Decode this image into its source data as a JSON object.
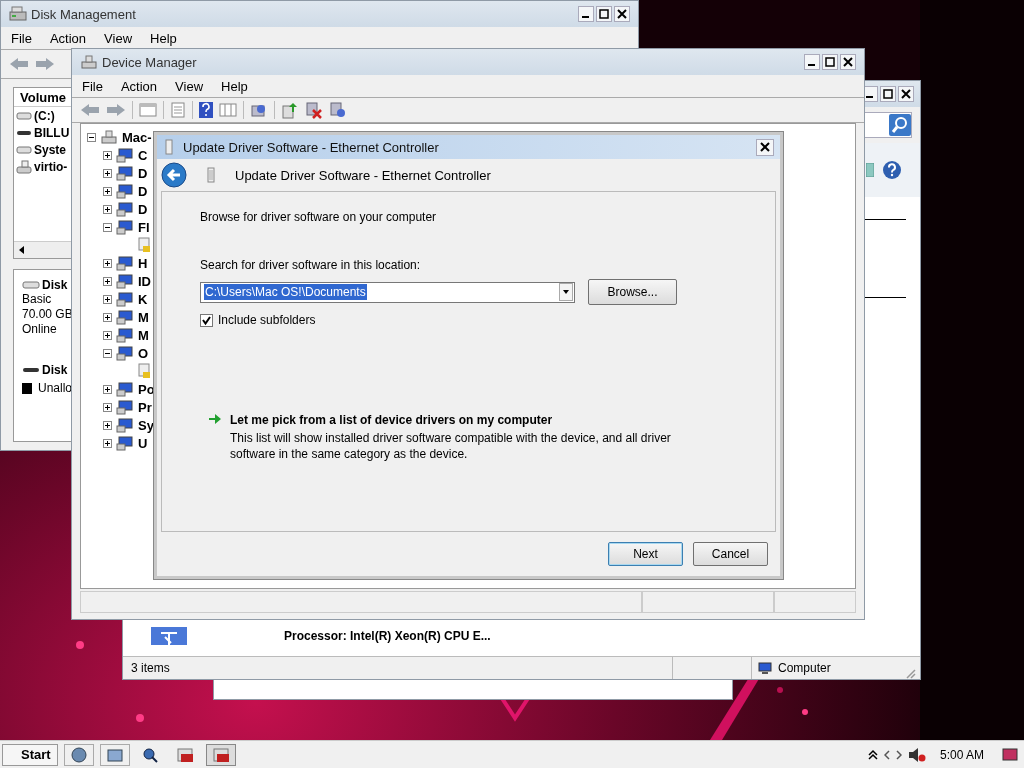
{
  "disk_management": {
    "title": "Disk Management",
    "menu": [
      "File",
      "Action",
      "View",
      "Help"
    ],
    "column_1": "Volume",
    "volumes": [
      {
        "label": "(C:)",
        "kind": "drive"
      },
      {
        "label": "BILLU",
        "kind": "optical"
      },
      {
        "label": "Syste",
        "kind": "drive"
      },
      {
        "label": "virtio-",
        "kind": "share"
      }
    ],
    "disks": [
      {
        "name": "Disk",
        "kind": "drive",
        "details": [
          "Basic",
          "70.00 GB",
          "Online"
        ]
      },
      {
        "name": "Disk",
        "kind": "optical"
      }
    ],
    "legend": "Unallo"
  },
  "computer_window": {
    "details": "Processor: Intel(R) Xeon(R) CPU E...",
    "status": "3 items",
    "location": "Computer"
  },
  "device_manager": {
    "title": "Device Manager",
    "menu": [
      "File",
      "Action",
      "View",
      "Help"
    ],
    "tree": {
      "label": "Mac-",
      "expanded": true,
      "children": [
        {
          "label": "C",
          "expanded": false
        },
        {
          "label": "D",
          "expanded": false
        },
        {
          "label": "D",
          "expanded": false
        },
        {
          "label": "D",
          "expanded": false
        },
        {
          "label": "Fl",
          "expanded": true,
          "children": [
            {
              "kind": "device"
            }
          ]
        },
        {
          "label": "H",
          "expanded": false
        },
        {
          "label": "ID",
          "expanded": false
        },
        {
          "label": "K",
          "expanded": false
        },
        {
          "label": "M",
          "expanded": false
        },
        {
          "label": "M",
          "expanded": false
        },
        {
          "label": "O",
          "expanded": true,
          "children": [
            {
              "kind": "device"
            }
          ]
        },
        {
          "label": "Po",
          "expanded": false
        },
        {
          "label": "Pr",
          "expanded": false
        },
        {
          "label": "Sy",
          "expanded": false
        },
        {
          "label": "U",
          "expanded": false
        }
      ]
    }
  },
  "dialog": {
    "title": "Update Driver Software - Ethernet Controller",
    "header": "Update Driver Software - Ethernet Controller",
    "heading": "Browse for driver software on your computer",
    "location_label": "Search for driver software in this location:",
    "path": "C:\\Users\\Mac OS!\\Documents",
    "path_selected": true,
    "browse": "Browse...",
    "include_subfolders": {
      "label": "Include subfolders",
      "checked": true
    },
    "pick_link": {
      "title": "Let me pick from a list of device drivers on my computer",
      "description": "This list will show installed driver software compatible with the device, and all driver software in the same category as the device."
    },
    "buttons": {
      "next": "Next",
      "cancel": "Cancel"
    }
  },
  "taskbar": {
    "start": "Start",
    "tasks": [
      {
        "selected": false
      },
      {
        "selected": true
      }
    ],
    "clock": "5:00 AM"
  }
}
